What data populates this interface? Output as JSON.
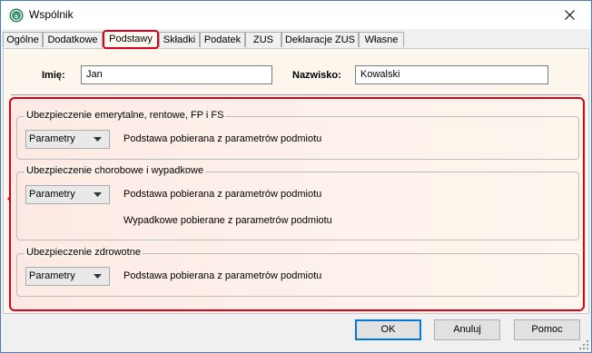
{
  "window": {
    "title": "Wspólnik",
    "icon": "app-logo-icon",
    "close_icon": "close-icon"
  },
  "tabs": [
    {
      "label": "Ogólne"
    },
    {
      "label": "Dodatkowe"
    },
    {
      "label": "Podstawy",
      "active": true
    },
    {
      "label": "Składki"
    },
    {
      "label": "Podatek"
    },
    {
      "label": "ZUS"
    },
    {
      "label": "Deklaracje ZUS"
    },
    {
      "label": "Własne"
    }
  ],
  "person": {
    "first_name_label": "Imię:",
    "first_name_value": "Jan",
    "last_name_label": "Nazwisko:",
    "last_name_value": "Kowalski"
  },
  "groups": [
    {
      "title": "Ubezpieczenie emerytalne, rentowe, FP i FS",
      "select_value": "Parametry",
      "info": "Podstawa pobierana z parametrów podmiotu"
    },
    {
      "title": "Ubezpieczenie chorobowe i wypadkowe",
      "select_value": "Parametry",
      "info": "Podstawa pobierana z parametrów podmiotu",
      "info2": "Wypadkowe pobierane z parametrów podmiotu"
    },
    {
      "title": "Ubezpieczenie zdrowotne",
      "select_value": "Parametry",
      "info": "Podstawa pobierana z parametrów podmiotu"
    }
  ],
  "buttons": {
    "ok": "OK",
    "cancel": "Anuluj",
    "help": "Pomoc"
  },
  "colors": {
    "highlight": "#d9001b",
    "panel": "#fdf6ed",
    "focus": "#0078d7"
  }
}
